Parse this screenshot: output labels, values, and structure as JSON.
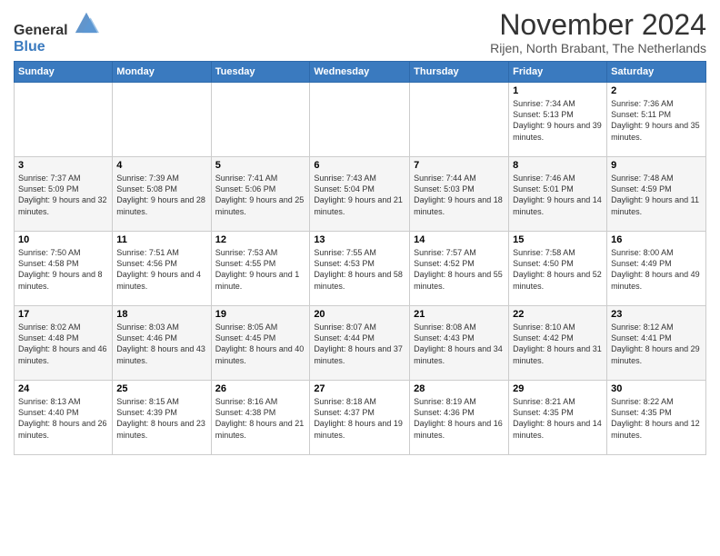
{
  "logo": {
    "general": "General",
    "blue": "Blue"
  },
  "header": {
    "month": "November 2024",
    "location": "Rijen, North Brabant, The Netherlands"
  },
  "days_of_week": [
    "Sunday",
    "Monday",
    "Tuesday",
    "Wednesday",
    "Thursday",
    "Friday",
    "Saturday"
  ],
  "weeks": [
    [
      {
        "day": "",
        "info": ""
      },
      {
        "day": "",
        "info": ""
      },
      {
        "day": "",
        "info": ""
      },
      {
        "day": "",
        "info": ""
      },
      {
        "day": "",
        "info": ""
      },
      {
        "day": "1",
        "info": "Sunrise: 7:34 AM\nSunset: 5:13 PM\nDaylight: 9 hours and 39 minutes."
      },
      {
        "day": "2",
        "info": "Sunrise: 7:36 AM\nSunset: 5:11 PM\nDaylight: 9 hours and 35 minutes."
      }
    ],
    [
      {
        "day": "3",
        "info": "Sunrise: 7:37 AM\nSunset: 5:09 PM\nDaylight: 9 hours and 32 minutes."
      },
      {
        "day": "4",
        "info": "Sunrise: 7:39 AM\nSunset: 5:08 PM\nDaylight: 9 hours and 28 minutes."
      },
      {
        "day": "5",
        "info": "Sunrise: 7:41 AM\nSunset: 5:06 PM\nDaylight: 9 hours and 25 minutes."
      },
      {
        "day": "6",
        "info": "Sunrise: 7:43 AM\nSunset: 5:04 PM\nDaylight: 9 hours and 21 minutes."
      },
      {
        "day": "7",
        "info": "Sunrise: 7:44 AM\nSunset: 5:03 PM\nDaylight: 9 hours and 18 minutes."
      },
      {
        "day": "8",
        "info": "Sunrise: 7:46 AM\nSunset: 5:01 PM\nDaylight: 9 hours and 14 minutes."
      },
      {
        "day": "9",
        "info": "Sunrise: 7:48 AM\nSunset: 4:59 PM\nDaylight: 9 hours and 11 minutes."
      }
    ],
    [
      {
        "day": "10",
        "info": "Sunrise: 7:50 AM\nSunset: 4:58 PM\nDaylight: 9 hours and 8 minutes."
      },
      {
        "day": "11",
        "info": "Sunrise: 7:51 AM\nSunset: 4:56 PM\nDaylight: 9 hours and 4 minutes."
      },
      {
        "day": "12",
        "info": "Sunrise: 7:53 AM\nSunset: 4:55 PM\nDaylight: 9 hours and 1 minute."
      },
      {
        "day": "13",
        "info": "Sunrise: 7:55 AM\nSunset: 4:53 PM\nDaylight: 8 hours and 58 minutes."
      },
      {
        "day": "14",
        "info": "Sunrise: 7:57 AM\nSunset: 4:52 PM\nDaylight: 8 hours and 55 minutes."
      },
      {
        "day": "15",
        "info": "Sunrise: 7:58 AM\nSunset: 4:50 PM\nDaylight: 8 hours and 52 minutes."
      },
      {
        "day": "16",
        "info": "Sunrise: 8:00 AM\nSunset: 4:49 PM\nDaylight: 8 hours and 49 minutes."
      }
    ],
    [
      {
        "day": "17",
        "info": "Sunrise: 8:02 AM\nSunset: 4:48 PM\nDaylight: 8 hours and 46 minutes."
      },
      {
        "day": "18",
        "info": "Sunrise: 8:03 AM\nSunset: 4:46 PM\nDaylight: 8 hours and 43 minutes."
      },
      {
        "day": "19",
        "info": "Sunrise: 8:05 AM\nSunset: 4:45 PM\nDaylight: 8 hours and 40 minutes."
      },
      {
        "day": "20",
        "info": "Sunrise: 8:07 AM\nSunset: 4:44 PM\nDaylight: 8 hours and 37 minutes."
      },
      {
        "day": "21",
        "info": "Sunrise: 8:08 AM\nSunset: 4:43 PM\nDaylight: 8 hours and 34 minutes."
      },
      {
        "day": "22",
        "info": "Sunrise: 8:10 AM\nSunset: 4:42 PM\nDaylight: 8 hours and 31 minutes."
      },
      {
        "day": "23",
        "info": "Sunrise: 8:12 AM\nSunset: 4:41 PM\nDaylight: 8 hours and 29 minutes."
      }
    ],
    [
      {
        "day": "24",
        "info": "Sunrise: 8:13 AM\nSunset: 4:40 PM\nDaylight: 8 hours and 26 minutes."
      },
      {
        "day": "25",
        "info": "Sunrise: 8:15 AM\nSunset: 4:39 PM\nDaylight: 8 hours and 23 minutes."
      },
      {
        "day": "26",
        "info": "Sunrise: 8:16 AM\nSunset: 4:38 PM\nDaylight: 8 hours and 21 minutes."
      },
      {
        "day": "27",
        "info": "Sunrise: 8:18 AM\nSunset: 4:37 PM\nDaylight: 8 hours and 19 minutes."
      },
      {
        "day": "28",
        "info": "Sunrise: 8:19 AM\nSunset: 4:36 PM\nDaylight: 8 hours and 16 minutes."
      },
      {
        "day": "29",
        "info": "Sunrise: 8:21 AM\nSunset: 4:35 PM\nDaylight: 8 hours and 14 minutes."
      },
      {
        "day": "30",
        "info": "Sunrise: 8:22 AM\nSunset: 4:35 PM\nDaylight: 8 hours and 12 minutes."
      }
    ]
  ]
}
